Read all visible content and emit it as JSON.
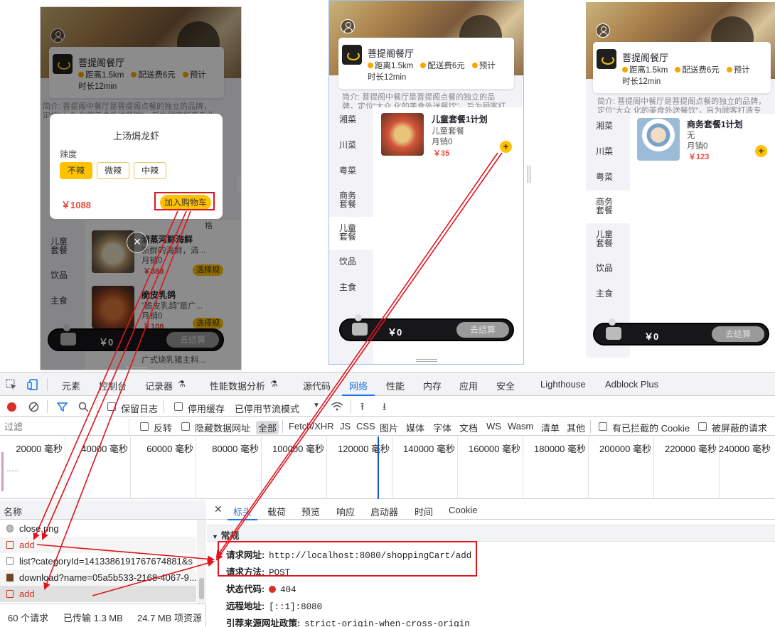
{
  "shop": {
    "name": "菩提阁餐厅",
    "distance": "距离1.5km",
    "delivery_fee": "配送费6元",
    "eta_prefix": "预计",
    "eta_suffix": "时长12min",
    "desc": "简介: 菩提阁中餐厅是菩提阁点餐的独立的品牌，定位“大众 化的美食外送餐饮”，旨为顾客打造专业美食"
  },
  "phone1": {
    "dialog": {
      "title": "上汤焗龙虾",
      "spice_label": "辣度",
      "options": [
        "不辣",
        "微辣",
        "中辣"
      ],
      "price": "￥1088",
      "add_btn": "加入购物车"
    },
    "categories": [
      "儿童套餐",
      "饮品",
      "主食"
    ],
    "foods": [
      {
        "name": "清蒸河鲜海鲜",
        "sub": "新鲜的海鲜，清...",
        "sales": "月销0",
        "price": "￥388",
        "spec": "选择规"
      },
      {
        "name": "脆皮乳鸽",
        "sub": "“脆皮乳鸽”是广...",
        "sales": "月销0",
        "price": "￥108",
        "spec": "选择规"
      }
    ],
    "peek_text": "广式烧乳猪主料...",
    "spec_top_tail": "格",
    "cart_amount": "￥0",
    "checkout": "去结算"
  },
  "phone2": {
    "categories": [
      "湘菜",
      "川菜",
      "粤菜",
      "商务套餐",
      "儿童套餐",
      "饮品",
      "主食"
    ],
    "food": {
      "name": "儿童套餐1计划",
      "sub": "儿童套餐",
      "sales": "月销0",
      "price": "￥35"
    },
    "cart_amount": "￥0",
    "checkout": "去结算"
  },
  "phone3": {
    "categories": [
      "湘菜",
      "川菜",
      "粤菜",
      "商务套餐",
      "儿童套餐",
      "饮品",
      "主食"
    ],
    "food": {
      "name": "商务套餐1计划",
      "sub": "无",
      "sales": "月销0",
      "price": "￥123"
    },
    "cart_amount": "￥0",
    "checkout": "去结算"
  },
  "devtools": {
    "tabs": [
      "元素",
      "控制台",
      "记录器",
      "性能数据分析",
      "源代码",
      "网络",
      "性能",
      "内存",
      "应用",
      "安全",
      "Lighthouse",
      "Adblock Plus"
    ],
    "toolbar": {
      "preserve_log": "保留日志",
      "disable_cache": "停用缓存",
      "throttle": "已停用节流模式"
    },
    "filter_placeholder": "过滤",
    "filter_opts": [
      "反转",
      "隐藏数据网址"
    ],
    "types": [
      "全部",
      "Fetch/XHR",
      "JS",
      "CSS",
      "图片",
      "媒体",
      "字体",
      "文档",
      "WS",
      "Wasm",
      "清单",
      "其他"
    ],
    "blocked_cookies": "有已拦截的 Cookie",
    "blocked_requests": "被屏蔽的请求",
    "timeline_ticks": [
      "20000 毫秒",
      "40000 毫秒",
      "60000 毫秒",
      "80000 毫秒",
      "100000 毫秒",
      "120000 毫秒",
      "140000 毫秒",
      "160000 毫秒",
      "180000 毫秒",
      "200000 毫秒",
      "220000 毫秒",
      "240000 毫秒"
    ],
    "name_header": "名称",
    "requests": [
      "close.png",
      "add",
      "list?categoryId=1413386191767674881&s",
      "download?name=05a5b533-2168-4067-9...",
      "add"
    ],
    "status_bar": {
      "requests": "60 个请求",
      "transferred": "已传输 1.3 MB",
      "resources": "24.7 MB 项资源"
    },
    "detail_tabs": [
      "标头",
      "载荷",
      "预览",
      "响应",
      "启动器",
      "时间",
      "Cookie"
    ],
    "general_title": "常规",
    "general": [
      {
        "k": "请求网址:",
        "v": "http://localhost:8080/shoppingCart/add"
      },
      {
        "k": "请求方法:",
        "v": "POST"
      },
      {
        "k": "状态代码:",
        "v": "404"
      },
      {
        "k": "远程地址:",
        "v": "[::1]:8080"
      },
      {
        "k": "引荐来源网址政策:",
        "v": "strict-origin-when-cross-origin"
      }
    ]
  },
  "colors": {
    "accent_yellow": "#ffc200",
    "price_red": "#e94e3c",
    "annotation_red": "#e0141e",
    "devtools_blue": "#1a73e8"
  }
}
